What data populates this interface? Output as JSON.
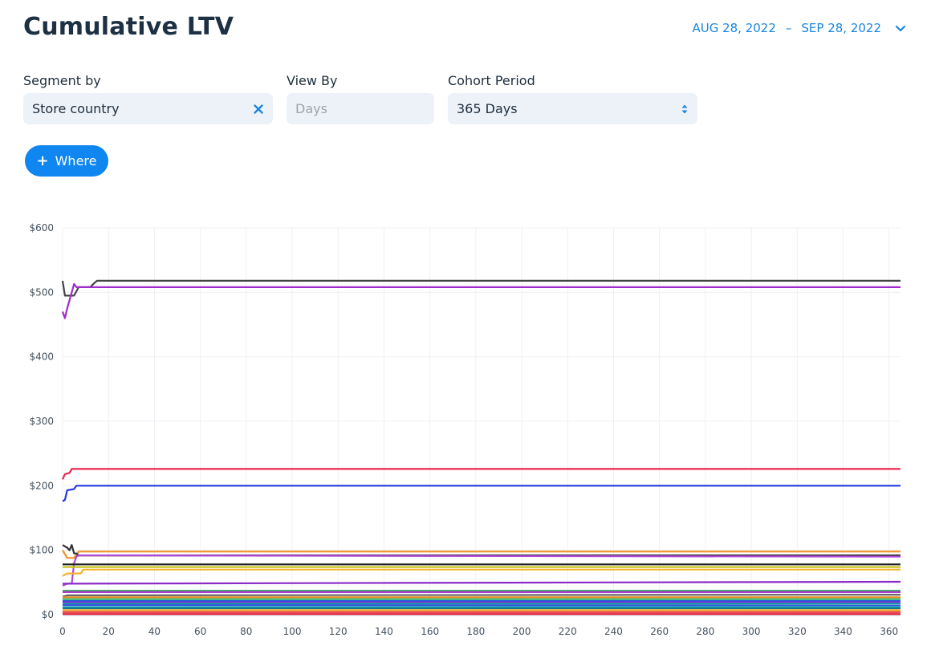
{
  "header": {
    "title": "Cumulative LTV",
    "date_start": "AUG 28, 2022",
    "date_separator": "–",
    "date_end": "SEP 28, 2022"
  },
  "filters": {
    "segment": {
      "label": "Segment by",
      "value": "Store country"
    },
    "view_by": {
      "label": "View By",
      "placeholder": "Days"
    },
    "cohort": {
      "label": "Cohort Period",
      "value": "365 Days"
    }
  },
  "where_button": {
    "label": "Where"
  },
  "colors": {
    "accent": "#0f86f0",
    "field_bg": "#edf2f8",
    "title": "#1e3043"
  },
  "chart_data": {
    "type": "line",
    "xlabel": "",
    "ylabel": "",
    "xlim": [
      0,
      365
    ],
    "ylim": [
      0,
      600
    ],
    "x_ticks": [
      "0",
      "20",
      "40",
      "60",
      "80",
      "100",
      "120",
      "140",
      "160",
      "180",
      "200",
      "220",
      "240",
      "260",
      "280",
      "300",
      "320",
      "340",
      "360"
    ],
    "y_ticks": [
      "$0",
      "$100",
      "$200",
      "$300",
      "$400",
      "$500",
      "$600"
    ],
    "grid": true,
    "legend": "none",
    "series": [
      {
        "color": "#444444",
        "points": [
          [
            0,
            518
          ],
          [
            1,
            495
          ],
          [
            5,
            495
          ],
          [
            7,
            508
          ],
          [
            12,
            508
          ],
          [
            14,
            515
          ],
          [
            15,
            518
          ],
          [
            365,
            518
          ]
        ]
      },
      {
        "color": "#a02bc9",
        "points": [
          [
            0,
            470
          ],
          [
            1,
            460
          ],
          [
            2,
            475
          ],
          [
            5,
            513
          ],
          [
            6,
            508
          ],
          [
            365,
            508
          ]
        ]
      },
      {
        "color": "#e8264f",
        "points": [
          [
            0,
            210
          ],
          [
            1,
            218
          ],
          [
            3,
            220
          ],
          [
            4,
            226
          ],
          [
            365,
            226
          ]
        ]
      },
      {
        "color": "#2639e0",
        "points": [
          [
            0,
            176
          ],
          [
            1,
            178
          ],
          [
            2,
            193
          ],
          [
            5,
            195
          ],
          [
            6,
            200
          ],
          [
            365,
            200
          ]
        ]
      },
      {
        "color": "#f2922a",
        "points": [
          [
            0,
            100
          ],
          [
            2,
            88
          ],
          [
            5,
            88
          ],
          [
            7,
            98
          ],
          [
            365,
            98
          ]
        ]
      },
      {
        "color": "#333333",
        "points": [
          [
            0,
            108
          ],
          [
            2,
            104
          ],
          [
            3,
            100
          ],
          [
            4,
            108
          ],
          [
            5,
            95
          ],
          [
            6,
            95
          ],
          [
            7,
            92
          ],
          [
            8,
            92
          ],
          [
            365,
            92
          ]
        ]
      },
      {
        "color": "#b04ad6",
        "points": [
          [
            0,
            45
          ],
          [
            2,
            48
          ],
          [
            4,
            48
          ],
          [
            5,
            80
          ],
          [
            6,
            90
          ],
          [
            7,
            92
          ],
          [
            365,
            90
          ]
        ]
      },
      {
        "color": "#222222",
        "points": [
          [
            0,
            78
          ],
          [
            365,
            78
          ]
        ]
      },
      {
        "color": "#c8c31a",
        "points": [
          [
            0,
            74
          ],
          [
            365,
            74
          ]
        ]
      },
      {
        "color": "#f5b028",
        "points": [
          [
            0,
            60
          ],
          [
            2,
            64
          ],
          [
            8,
            64
          ],
          [
            9,
            70
          ],
          [
            365,
            70
          ]
        ]
      },
      {
        "color": "#8a2bc7",
        "points": [
          [
            0,
            48
          ],
          [
            365,
            51
          ]
        ]
      },
      {
        "color": "#1e9e4a",
        "points": [
          [
            0,
            37
          ],
          [
            365,
            37
          ]
        ]
      },
      {
        "color": "#b13bd1",
        "points": [
          [
            0,
            35
          ],
          [
            365,
            35
          ]
        ]
      },
      {
        "color": "#666666",
        "points": [
          [
            0,
            28
          ],
          [
            2,
            30
          ],
          [
            365,
            31
          ]
        ]
      },
      {
        "color": "#e98a1c",
        "points": [
          [
            0,
            27
          ],
          [
            365,
            27
          ]
        ]
      },
      {
        "color": "#27b36a",
        "points": [
          [
            0,
            24
          ],
          [
            365,
            24
          ]
        ]
      },
      {
        "color": "#1f4fe0",
        "points": [
          [
            0,
            21
          ],
          [
            365,
            21
          ]
        ]
      },
      {
        "color": "#8c2fd1",
        "points": [
          [
            0,
            19
          ],
          [
            365,
            19
          ]
        ]
      },
      {
        "color": "#11a0a8",
        "points": [
          [
            0,
            17
          ],
          [
            365,
            17
          ]
        ]
      },
      {
        "color": "#3557d8",
        "points": [
          [
            0,
            15
          ],
          [
            365,
            14
          ]
        ]
      },
      {
        "color": "#2aa9c8",
        "points": [
          [
            0,
            12
          ],
          [
            365,
            12
          ]
        ]
      },
      {
        "color": "#0e7a8a",
        "points": [
          [
            0,
            10
          ],
          [
            365,
            10
          ]
        ]
      },
      {
        "color": "#f0a52e",
        "points": [
          [
            0,
            7
          ],
          [
            365,
            7
          ]
        ]
      },
      {
        "color": "#e73b3b",
        "points": [
          [
            0,
            4
          ],
          [
            365,
            4
          ]
        ]
      },
      {
        "color": "#e31c3a",
        "points": [
          [
            0,
            1
          ],
          [
            365,
            1
          ]
        ]
      }
    ]
  }
}
